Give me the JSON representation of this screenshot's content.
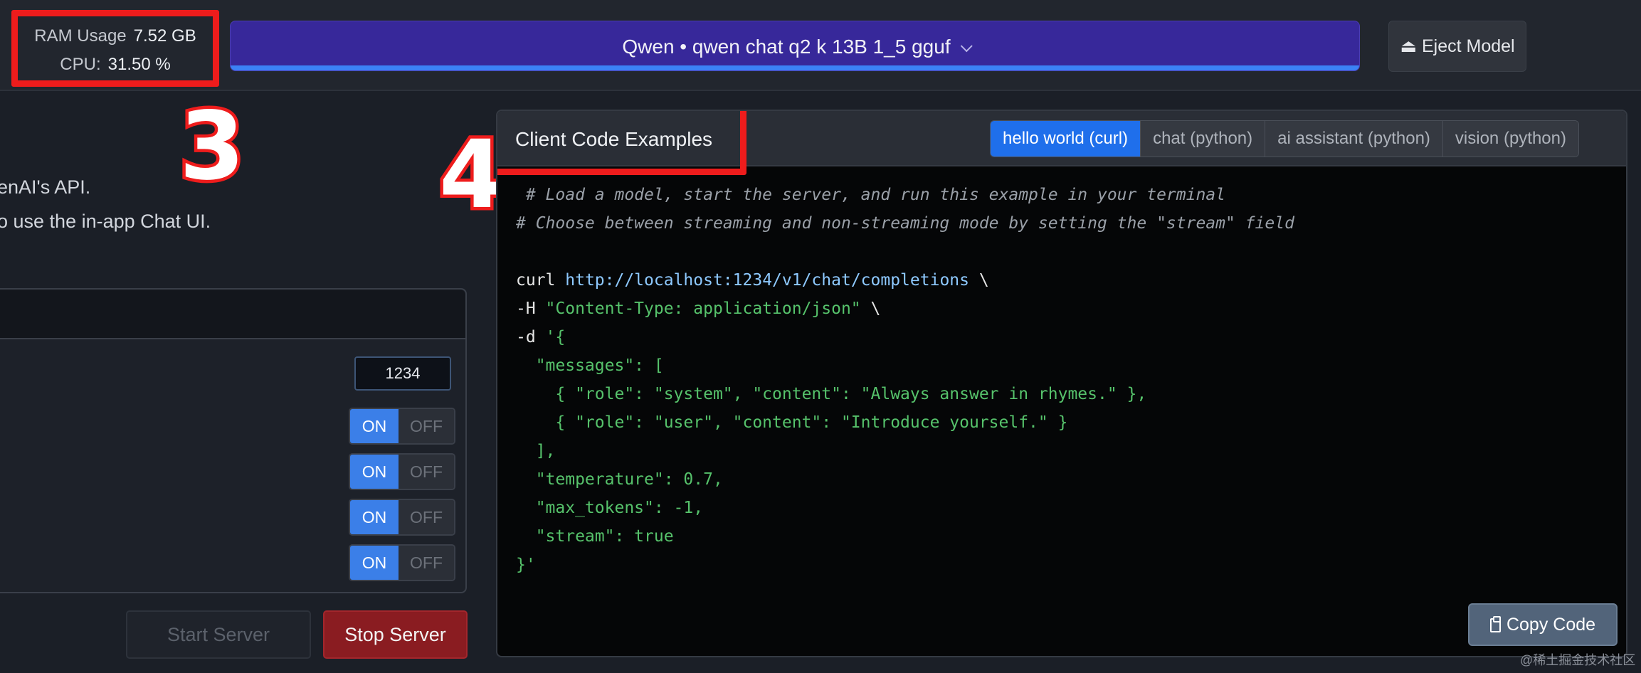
{
  "resources": {
    "ram_label": "RAM Usage",
    "ram_value": "7.52 GB",
    "cpu_label": "CPU:",
    "cpu_value": "31.50 %"
  },
  "model_selector": {
    "label": "Qwen • qwen chat q2 k 13B 1_5 gguf",
    "icon": "chevron-down-icon"
  },
  "eject": {
    "label": "⏏ Eject Model",
    "icon": "eject-icon"
  },
  "annotations": {
    "three": "3",
    "four": "4",
    "color": "#ee1c1c"
  },
  "left_panel": {
    "text_line_1": "enAI's API.",
    "text_line_2": "o use the in-app Chat UI.",
    "port_value": "1234",
    "toggles": [
      {
        "on": "ON",
        "off": "OFF"
      },
      {
        "on": "ON",
        "off": "OFF"
      },
      {
        "on": "ON",
        "off": "OFF"
      },
      {
        "on": "ON",
        "off": "OFF"
      }
    ],
    "start_button": "Start Server",
    "stop_button": "Stop Server"
  },
  "code_panel": {
    "title": "Client Code Examples",
    "tabs": [
      {
        "label": "hello world (curl)",
        "active": true
      },
      {
        "label": "chat (python)",
        "active": false
      },
      {
        "label": "ai assistant (python)",
        "active": false
      },
      {
        "label": "vision (python)",
        "active": false
      }
    ],
    "code": {
      "l1": " # Load a model, start the server, and run this example in your terminal",
      "l2": "# Choose between streaming and non-streaming mode by setting the \"stream\" field",
      "l4_cmd": "curl ",
      "l4_url": "http://localhost:1234/v1/chat/completions",
      "l4_tail": " \\",
      "l5_flag": "-H ",
      "l5_str": "\"Content-Type: application/json\"",
      "l5_tail": " \\",
      "l6_flag": "-d ",
      "l6_str": "'{",
      "l7": "  \"messages\": [",
      "l8": "    { \"role\": \"system\", \"content\": \"Always answer in rhymes.\" },",
      "l9": "    { \"role\": \"user\", \"content\": \"Introduce yourself.\" }",
      "l10": "  ],",
      "l11": "  \"temperature\": 0.7,",
      "l12": "  \"max_tokens\": -1,",
      "l13": "  \"stream\": true",
      "l14": "}'"
    },
    "copy_button": "Copy Code",
    "copy_icon": "clipboard-icon"
  },
  "watermark": "@稀土掘金技术社区",
  "colors": {
    "accent": "#3b82f6",
    "model_bar": "#37289a",
    "stop": "#8a1c21",
    "tab_active": "#1f6feb"
  }
}
